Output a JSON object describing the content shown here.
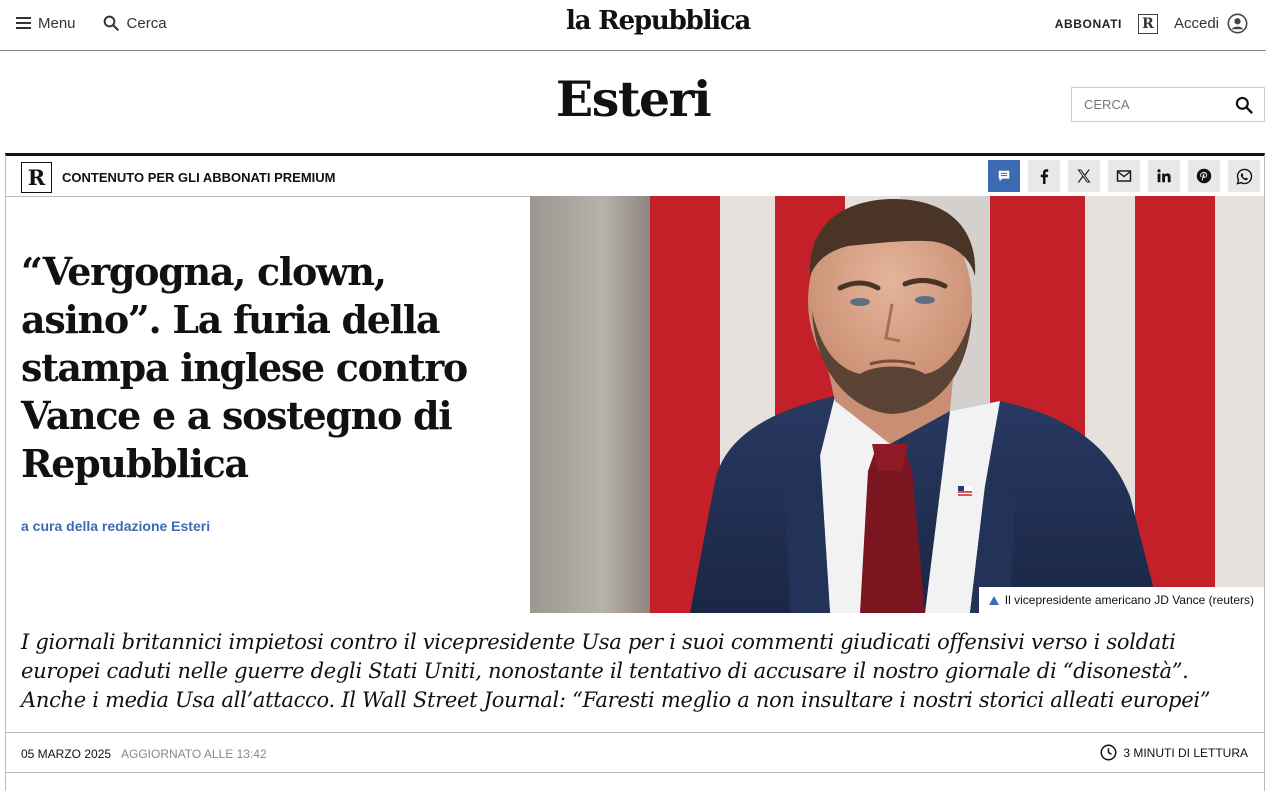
{
  "nav": {
    "menu_label": "Menu",
    "search_label": "Cerca",
    "logo": "la Repubblica",
    "subscribe_label": "ABBONATI",
    "r_logo": "R",
    "login_label": "Accedi"
  },
  "section": {
    "title": "Esteri",
    "search_placeholder": "CERCA"
  },
  "article": {
    "premium_label": "CONTENUTO PER GLI ABBONATI PREMIUM",
    "premium_r": "R",
    "headline": "“Vergogna, clown, asino”. La furia della stampa inglese contro Vance e a sostegno di Repubblica",
    "byline": "a cura della redazione Esteri",
    "photo_caption": "Il vicepresidente americano JD Vance (reuters)",
    "summary": "I giornali britannici impietosi contro il vicepresidente Usa per i suoi commenti giudicati offensivi verso i soldati europei caduti nelle guerre degli Stati Uniti, nonostante il tentativo di accusare il nostro giornale di “disonestà”. Anche i media Usa all’attacco. Il Wall Street Journal: “Faresti meglio a non insultare i nostri storici alleati europei”",
    "date": "05 MARZO 2025",
    "updated": "AGGIORNATO ALLE 13:42",
    "read_time": "3 MINUTI DI LETTURA"
  },
  "share_icons": [
    "comment-icon",
    "facebook-icon",
    "x-icon",
    "mail-icon",
    "linkedin-icon",
    "pinterest-icon",
    "whatsapp-icon"
  ],
  "colors": {
    "accent_blue": "#3d6bb3",
    "share_bg": "#e8e8e8",
    "flag_red": "#c4202a",
    "suit_navy": "#1f2e52"
  }
}
